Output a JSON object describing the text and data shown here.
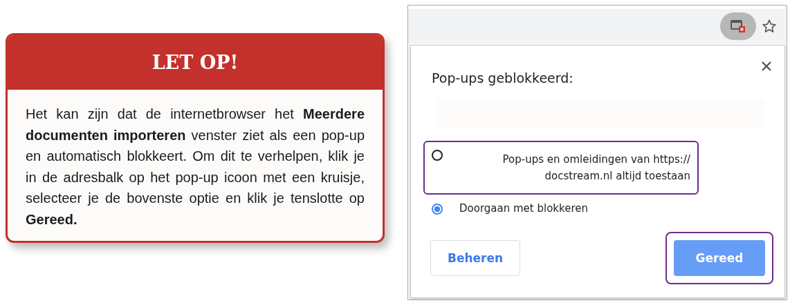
{
  "notice": {
    "title": "LET OP!",
    "text": "Het kan zijn dat de internetbrowser het **Meerdere documenten importeren** venster ziet als een pop-up  en automatisch blokkeert. Om dit te verhelpen, klik je in de adresbalk op het pop-up icoon met een kruisje, selecteer je de bovenste optie en klik je tenslotte op **Gereed.**"
  },
  "browser": {
    "popup_icon_active": true,
    "dialog": {
      "title": "Pop-ups geblokkeerd:",
      "options": [
        {
          "label": "Pop-ups en omleidingen van https:// docstream.nl altijd toestaan",
          "selected": false,
          "highlighted": true
        },
        {
          "label": "Doorgaan met blokkeren",
          "selected": true,
          "highlighted": false
        }
      ],
      "buttons": [
        {
          "label": "Beheren",
          "kind": "secondary",
          "highlighted": false
        },
        {
          "label": "Gereed",
          "kind": "primary",
          "highlighted": true
        }
      ]
    }
  }
}
